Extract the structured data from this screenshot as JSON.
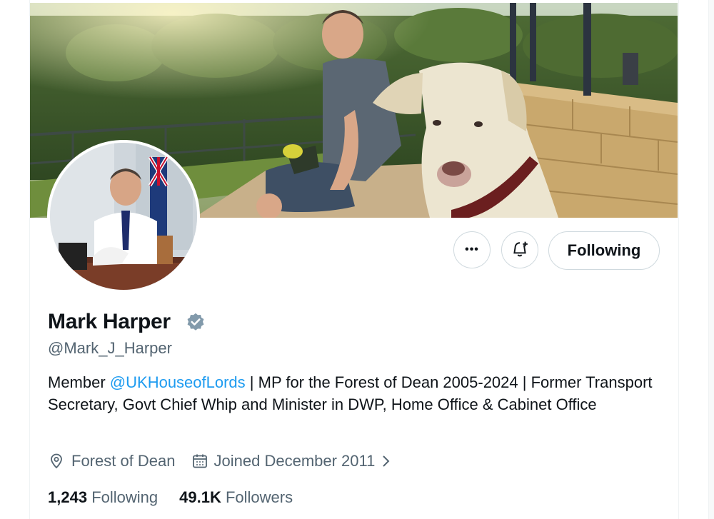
{
  "profile": {
    "name": "Mark Harper",
    "handle": "@Mark_J_Harper",
    "bio_prefix": "Member ",
    "bio_mention": "@UKHouseofLords",
    "bio_rest": " | MP for the Forest of Dean 2005-2024 | Former Transport Secretary, Govt Chief Whip and Minister in DWP, Home Office & Cabinet Office",
    "location": "Forest of Dean",
    "joined": "Joined December 2011",
    "following_count": "1,243",
    "following_label": "Following",
    "followers_count": "49.1K",
    "followers_label": "Followers"
  },
  "actions": {
    "more_label": "•••",
    "follow_state": "Following"
  },
  "icons": {
    "more": "more-icon",
    "notify": "bell-plus-icon",
    "verified": "verified-badge-icon",
    "location": "location-pin-icon",
    "calendar": "calendar-icon",
    "chevron": "chevron-right-icon"
  },
  "colors": {
    "link": "#1d9bf0",
    "muted": "#536471",
    "verified_badge": "#829aab"
  }
}
